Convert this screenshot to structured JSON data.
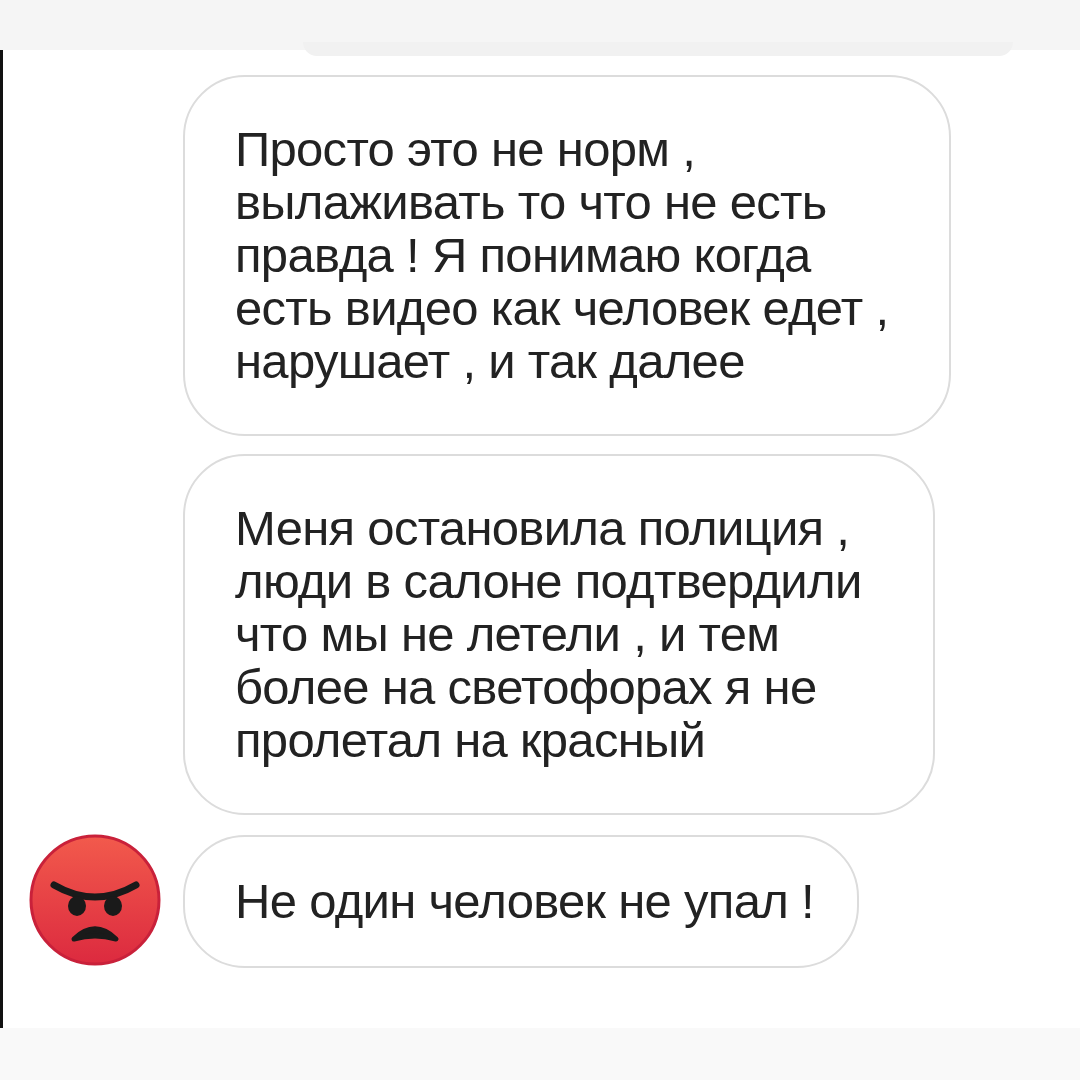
{
  "messages": [
    {
      "text": "Просто это не норм ,\nвылаживать то что не есть\nправда ! Я понимаю когда\nесть видео как человек едет ,\nнарушает , и так далее",
      "show_avatar": false
    },
    {
      "text": "Меня остановила полиция ,\nлюди в салоне подтвердили\nчто мы не летели , и тем\nболее на светофорах я не\nпролетал на красный",
      "show_avatar": false
    },
    {
      "text": "Не один человек не упал !",
      "show_avatar": true
    }
  ]
}
